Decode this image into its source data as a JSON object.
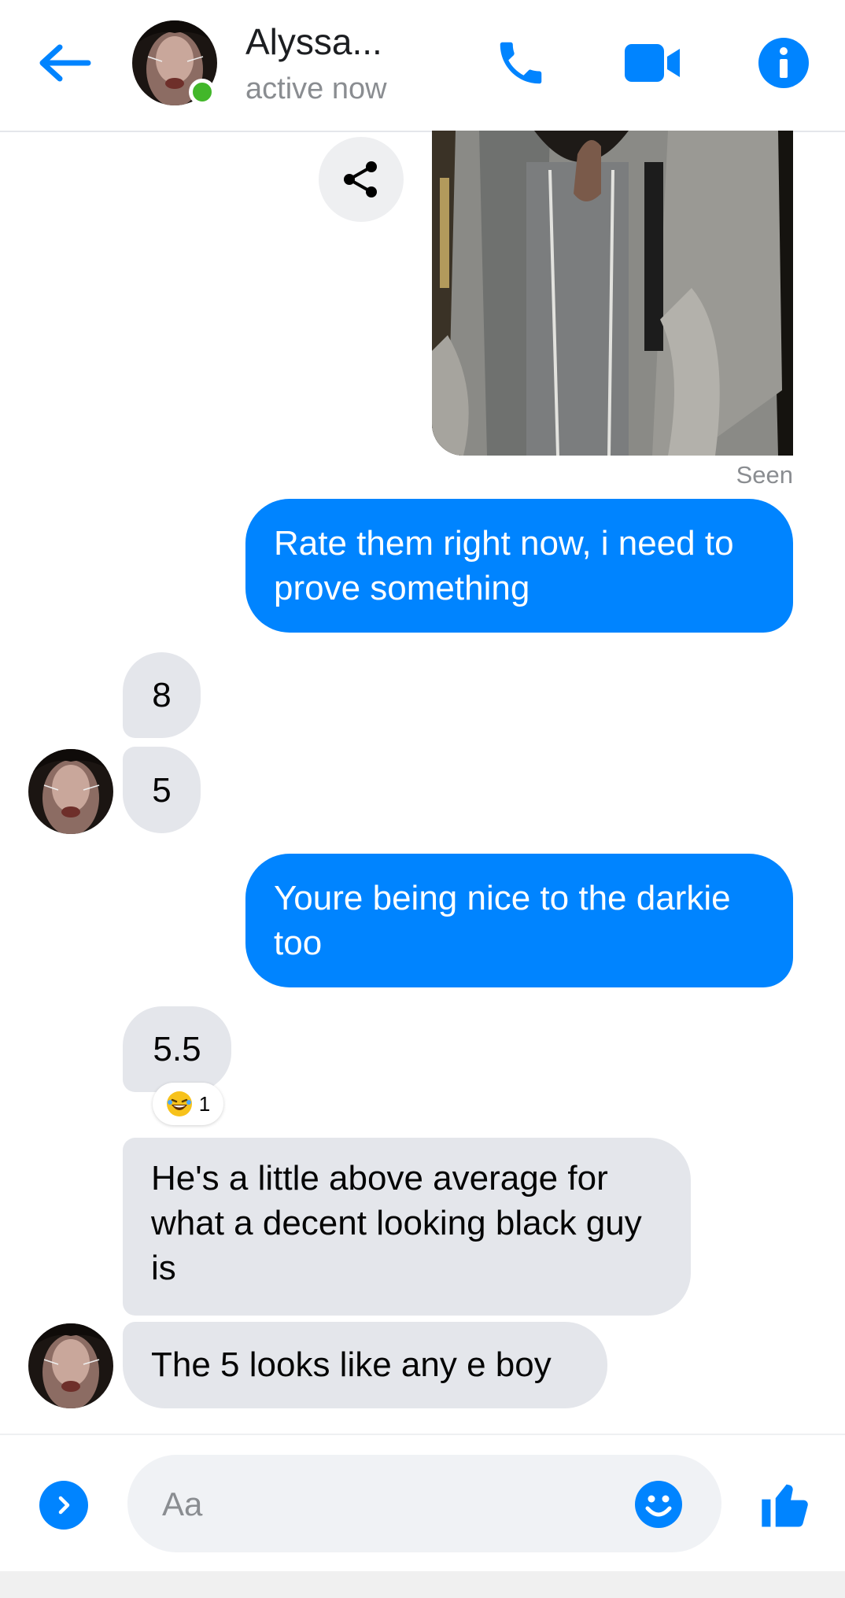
{
  "header": {
    "contact_name": "Alyssa...",
    "status": "active now"
  },
  "chat": {
    "seen_label": "Seen",
    "messages": [
      {
        "direction": "outgoing",
        "text": "Rate them right now, i need to prove something"
      },
      {
        "direction": "incoming",
        "text": "8"
      },
      {
        "direction": "incoming",
        "text": "5"
      },
      {
        "direction": "outgoing",
        "text": "Youre being nice to the darkie too"
      },
      {
        "direction": "incoming",
        "text": "5.5"
      },
      {
        "direction": "incoming",
        "text": "He's a little above average for what a decent looking black guy is"
      },
      {
        "direction": "incoming",
        "text": "The 5 looks like any e boy"
      }
    ],
    "reaction": {
      "emoji": "laughing-face",
      "count": "1"
    }
  },
  "composer": {
    "placeholder": "Aa"
  },
  "colors": {
    "accent": "#0084ff",
    "incoming_bubble": "#e4e6eb",
    "online": "#42b72a"
  },
  "icons": [
    "back-arrow-icon",
    "phone-icon",
    "video-camera-icon",
    "info-icon",
    "share-icon",
    "chevron-right-icon",
    "smiley-icon",
    "thumbs-up-icon"
  ]
}
